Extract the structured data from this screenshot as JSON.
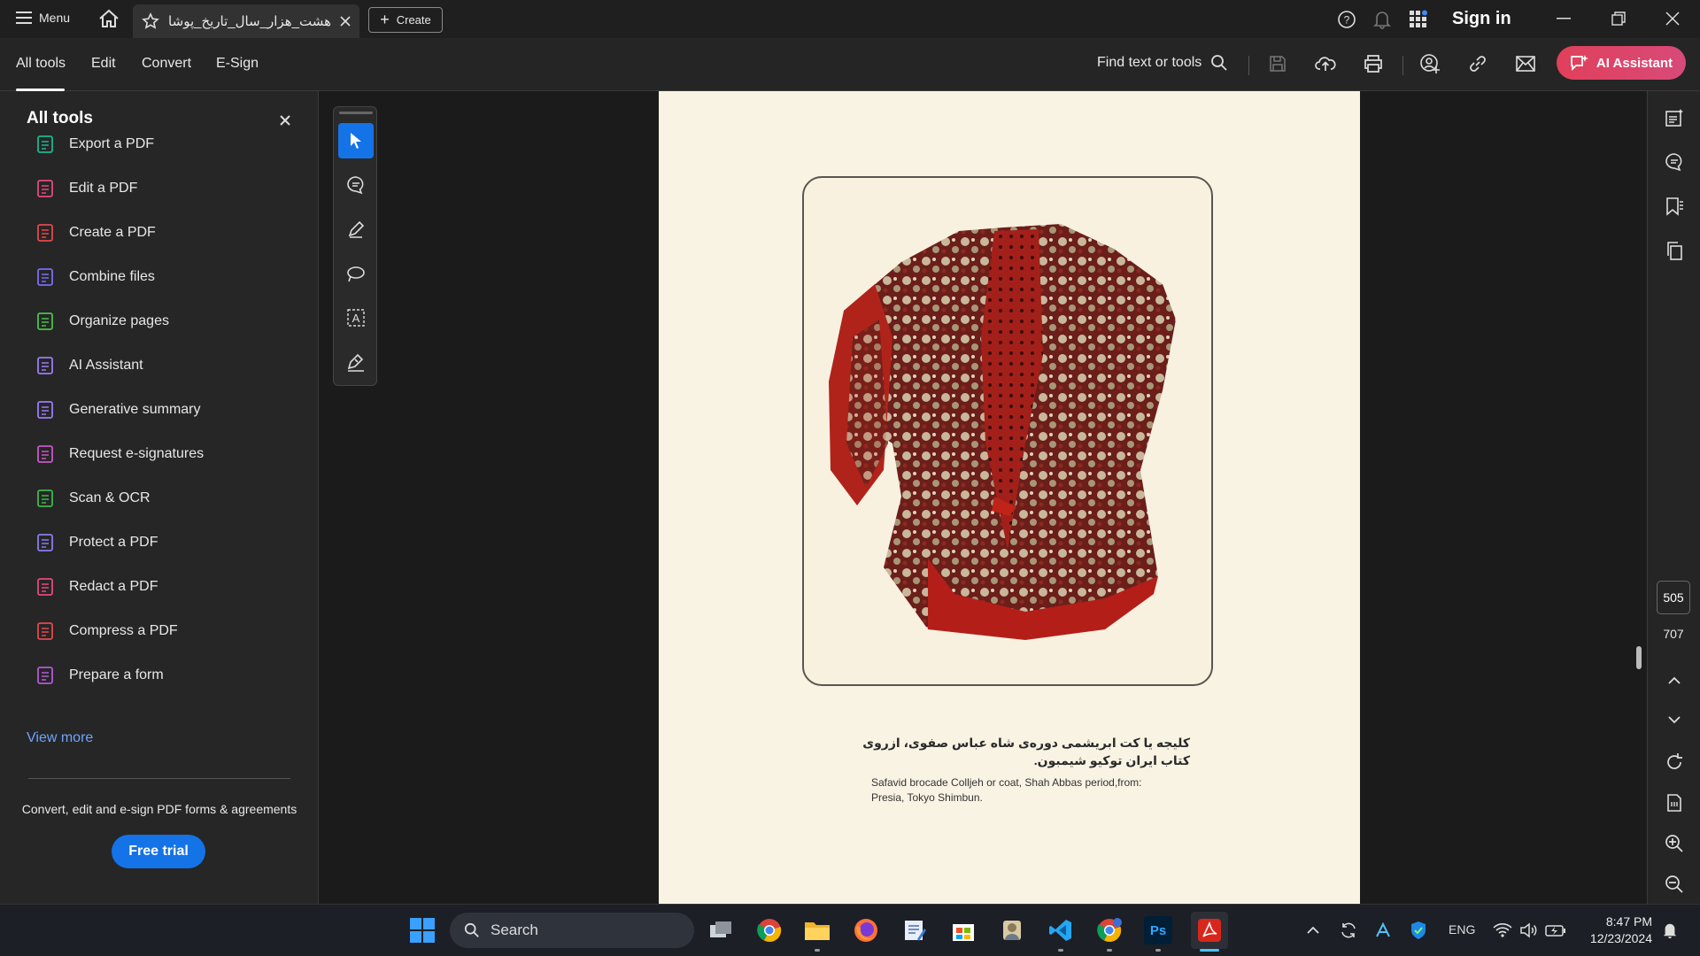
{
  "titlebar": {
    "menu_label": "Menu",
    "tab_title": "هشت_هزار_سال_تاریخ_پوشا..",
    "create_label": "Create",
    "sign_in": "Sign in"
  },
  "toolbar": {
    "tabs": [
      "All tools",
      "Edit",
      "Convert",
      "E-Sign"
    ],
    "find_label": "Find text or tools",
    "ai_label": "AI Assistant"
  },
  "panel": {
    "title": "All tools",
    "items": [
      {
        "label": "Export a PDF",
        "color": "#1eb58f"
      },
      {
        "label": "Edit a PDF",
        "color": "#e64980"
      },
      {
        "label": "Create a PDF",
        "color": "#e5484d"
      },
      {
        "label": "Combine files",
        "color": "#7b6cf6"
      },
      {
        "label": "Organize pages",
        "color": "#4cc04c"
      },
      {
        "label": "AI Assistant",
        "color": "#9a7cf8"
      },
      {
        "label": "Generative summary",
        "color": "#9a7cf8"
      },
      {
        "label": "Request e-signatures",
        "color": "#c957c9"
      },
      {
        "label": "Scan & OCR",
        "color": "#3cb84c"
      },
      {
        "label": "Protect a PDF",
        "color": "#8a7cf0"
      },
      {
        "label": "Redact a PDF",
        "color": "#e64980"
      },
      {
        "label": "Compress a PDF",
        "color": "#e5484d"
      },
      {
        "label": "Prepare a form",
        "color": "#b35ad8"
      }
    ],
    "view_more": "View more",
    "promo": "Convert, edit and e-sign PDF forms & agreements",
    "free_trial": "Free trial"
  },
  "document": {
    "caption_fa_line1": "کلیجه یا کت ابریشمی دوره‌ی شاه عباس صفوی، ازروی",
    "caption_fa_line2": "کتاب ایران توکیو شیمبون.",
    "caption_en_line1": "Safavid brocade Colljeh or coat, Shah Abbas period,from:",
    "caption_en_line2": "Presia, Tokyo Shimbun."
  },
  "pager": {
    "current": "505",
    "total": "707"
  },
  "taskbar": {
    "search_label": "Search",
    "lang": "ENG",
    "time": "8:47 PM",
    "date": "12/23/2024"
  },
  "colors": {
    "accent_blue": "#1473e6",
    "ai_gradient": "#e0405a",
    "page_bg": "#f9f3e4"
  }
}
